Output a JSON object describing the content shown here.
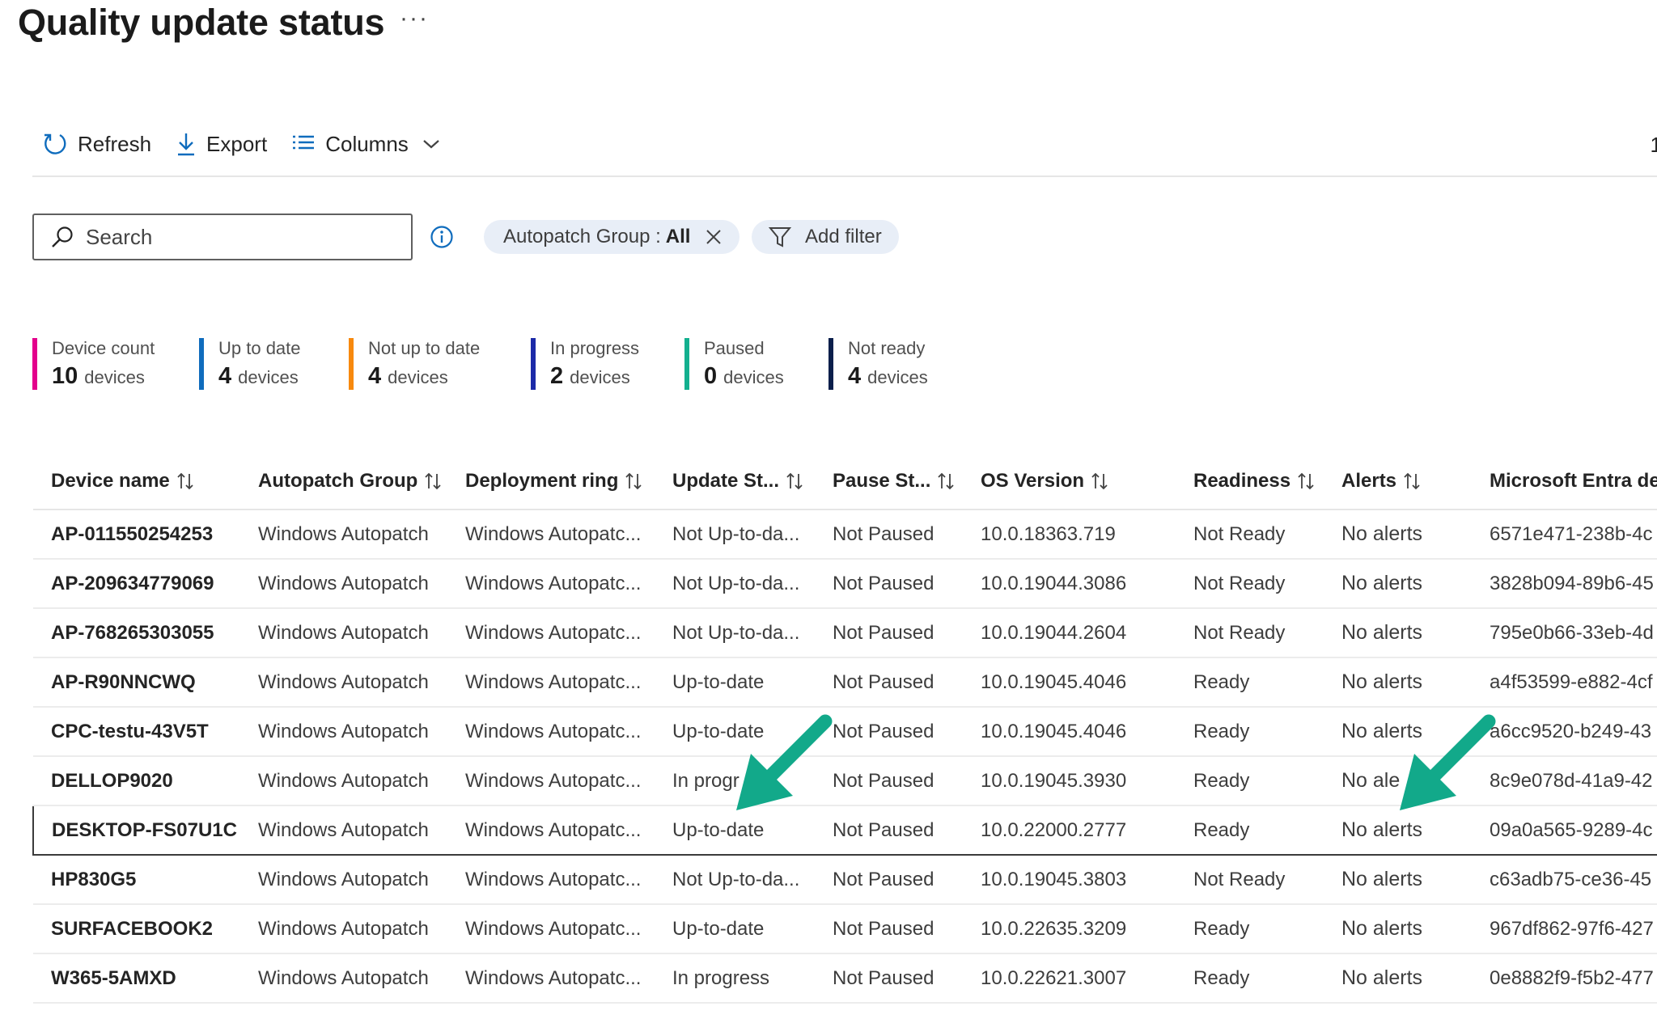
{
  "page": {
    "title": "Quality update status",
    "more_label": "···"
  },
  "toolbar": {
    "refresh_label": "Refresh",
    "export_label": "Export",
    "columns_label": "Columns",
    "right_text": "1"
  },
  "search": {
    "placeholder": "Search",
    "value": ""
  },
  "filters": {
    "group_label": "Autopatch Group :",
    "group_value": "All",
    "add_filter_label": "Add filter"
  },
  "stats": [
    {
      "label": "Device count",
      "count": "10",
      "unit": "devices",
      "color": "#e3008c"
    },
    {
      "label": "Up to date",
      "count": "4",
      "unit": "devices",
      "color": "#0f6cbd"
    },
    {
      "label": "Not up to date",
      "count": "4",
      "unit": "devices",
      "color": "#f7890e"
    },
    {
      "label": "In progress",
      "count": "2",
      "unit": "devices",
      "color": "#1c2aa8"
    },
    {
      "label": "Paused",
      "count": "0",
      "unit": "devices",
      "color": "#13b08f"
    },
    {
      "label": "Not ready",
      "count": "4",
      "unit": "devices",
      "color": "#0b1f4b"
    }
  ],
  "table": {
    "columns": [
      "Device name",
      "Autopatch Group",
      "Deployment ring",
      "Update St...",
      "Pause St...",
      "OS Version",
      "Readiness",
      "Alerts",
      "Microsoft Entra de"
    ],
    "rows": [
      [
        "AP-011550254253",
        "Windows Autopatch",
        "Windows Autopatc...",
        "Not Up-to-da...",
        "Not Paused",
        "10.0.18363.719",
        "Not Ready",
        "No alerts",
        "6571e471-238b-4c"
      ],
      [
        "AP-209634779069",
        "Windows Autopatch",
        "Windows Autopatc...",
        "Not Up-to-da...",
        "Not Paused",
        "10.0.19044.3086",
        "Not Ready",
        "No alerts",
        "3828b094-89b6-45"
      ],
      [
        "AP-768265303055",
        "Windows Autopatch",
        "Windows Autopatc...",
        "Not Up-to-da...",
        "Not Paused",
        "10.0.19044.2604",
        "Not Ready",
        "No alerts",
        "795e0b66-33eb-4d"
      ],
      [
        "AP-R90NNCWQ",
        "Windows Autopatch",
        "Windows Autopatc...",
        "Up-to-date",
        "Not Paused",
        "10.0.19045.4046",
        "Ready",
        "No alerts",
        "a4f53599-e882-4cf"
      ],
      [
        "CPC-testu-43V5T",
        "Windows Autopatch",
        "Windows Autopatc...",
        "Up-to-date",
        "Not Paused",
        "10.0.19045.4046",
        "Ready",
        "No alerts",
        "a6cc9520-b249-43"
      ],
      [
        "DELLOP9020",
        "Windows Autopatch",
        "Windows Autopatc...",
        "In progr",
        "Not Paused",
        "10.0.19045.3930",
        "Ready",
        "No ale",
        "8c9e078d-41a9-42"
      ],
      [
        "DESKTOP-FS07U1C",
        "Windows Autopatch",
        "Windows Autopatc...",
        "Up-to-date",
        "Not Paused",
        "10.0.22000.2777",
        "Ready",
        "No alerts",
        "09a0a565-9289-4c"
      ],
      [
        "HP830G5",
        "Windows Autopatch",
        "Windows Autopatc...",
        "Not Up-to-da...",
        "Not Paused",
        "10.0.19045.3803",
        "Not Ready",
        "No alerts",
        "c63adb75-ce36-45"
      ],
      [
        "SURFACEBOOK2",
        "Windows Autopatch",
        "Windows Autopatc...",
        "Up-to-date",
        "Not Paused",
        "10.0.22635.3209",
        "Ready",
        "No alerts",
        "967df862-97f6-427"
      ],
      [
        "W365-5AMXD",
        "Windows Autopatch",
        "Windows Autopatc...",
        "In progress",
        "Not Paused",
        "10.0.22621.3007",
        "Ready",
        "No alerts",
        "0e8882f9-f5b2-477"
      ]
    ],
    "selected_row": 6
  },
  "annotations": {
    "arrow_color": "#12a98a"
  }
}
